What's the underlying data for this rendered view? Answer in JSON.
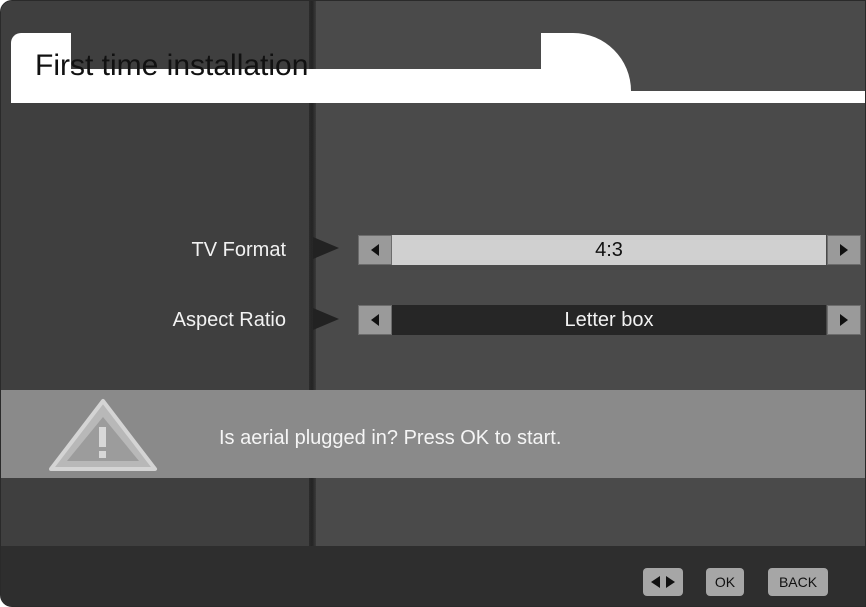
{
  "header": {
    "title": "First time installation"
  },
  "settings": [
    {
      "label": "TV Format",
      "value": "4:3"
    },
    {
      "label": "Aspect Ratio",
      "value": "Letter box"
    }
  ],
  "warning": {
    "icon": "warning-triangle-icon",
    "message": "Is aerial plugged in? Press OK to start."
  },
  "footer": {
    "nav_icon": "left-right-arrows-icon",
    "ok_label": "OK",
    "back_label": "BACK"
  },
  "colors": {
    "background": "#4a4a4a",
    "selected_field": "#d0d0d0",
    "unselected_field": "#262626",
    "warning_band": "#8a8a8a"
  }
}
